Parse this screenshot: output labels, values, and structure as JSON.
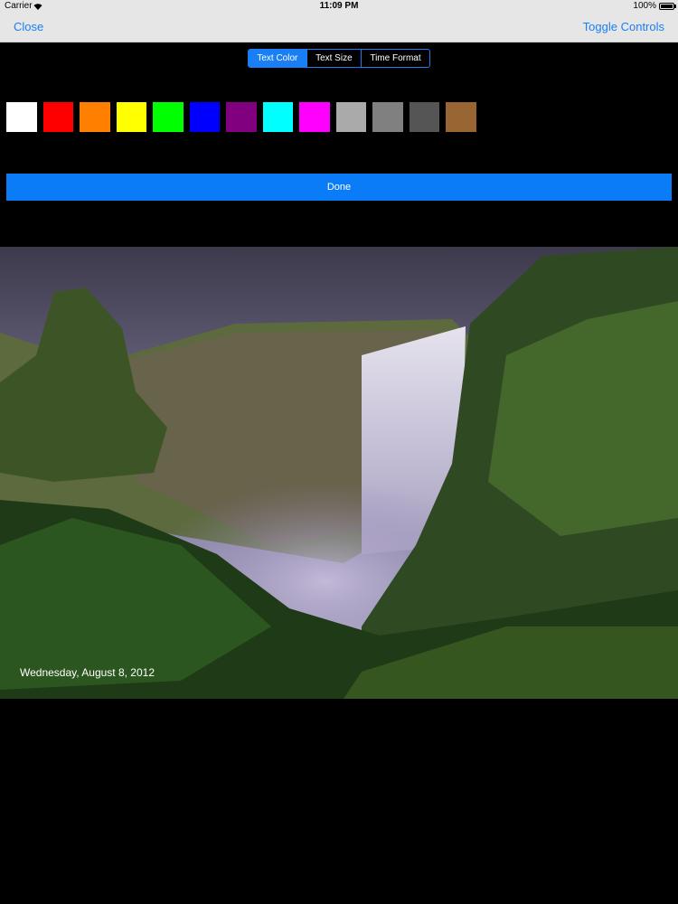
{
  "status_bar": {
    "carrier": "Carrier",
    "time": "11:09 PM",
    "battery": "100%"
  },
  "nav": {
    "close_label": "Close",
    "toggle_label": "Toggle Controls"
  },
  "segments": [
    "Text Color",
    "Text Size",
    "Time Format"
  ],
  "selected_segment": "Text Color",
  "accent_color": "#1a7ff5",
  "colors": [
    "#ffffff",
    "#ff0000",
    "#ff8000",
    "#ffff00",
    "#00ff00",
    "#0000ff",
    "#800080",
    "#00ffff",
    "#ff00ff",
    "#aaaaaa",
    "#808080",
    "#555555",
    "#996633"
  ],
  "done_label": "Done",
  "photo": {
    "date_text": "Wednesday, August 8, 2012"
  }
}
